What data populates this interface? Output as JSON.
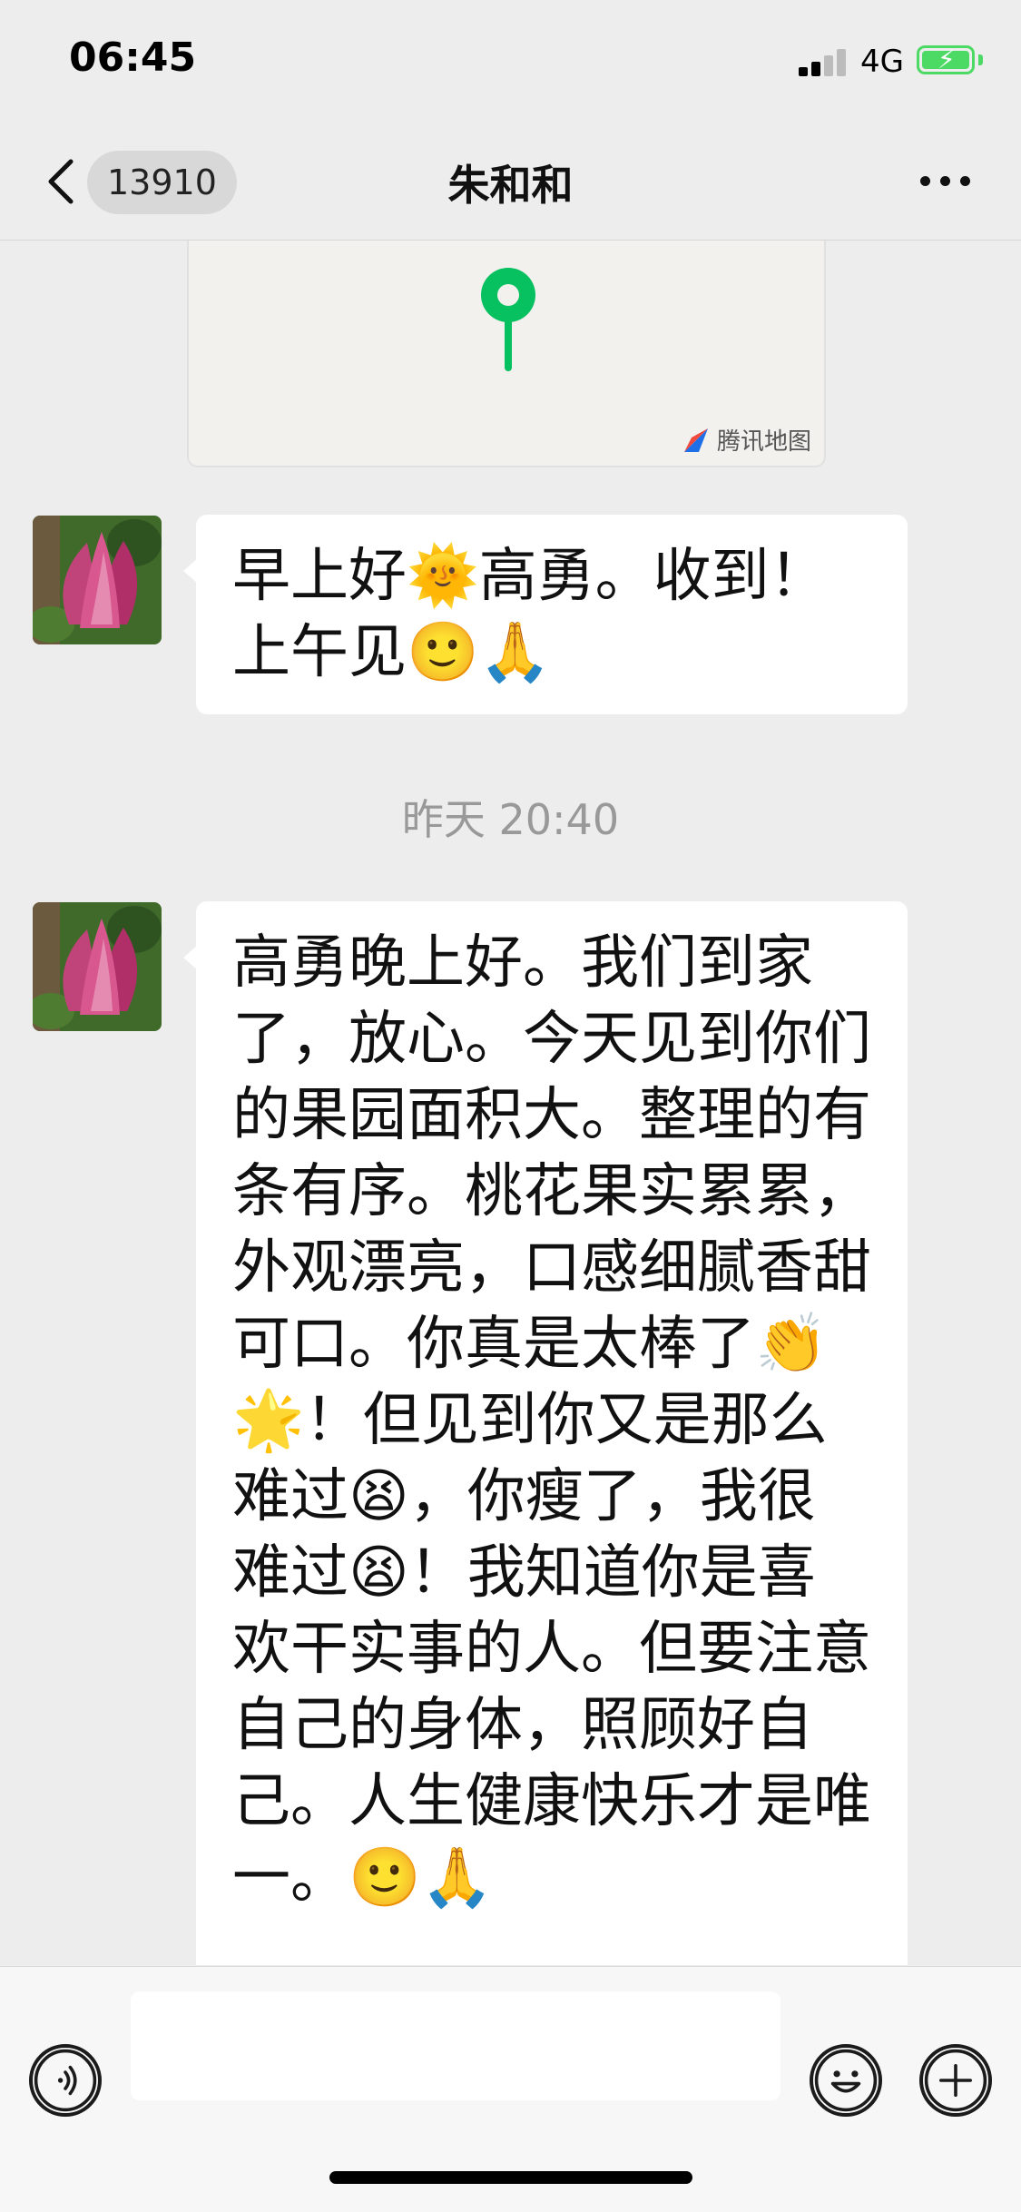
{
  "status_bar": {
    "time": "06:45",
    "network": "4G"
  },
  "nav": {
    "back_badge": "13910",
    "title": "朱和和"
  },
  "map_card": {
    "brand": "腾讯地图",
    "pin_color": "#07c160"
  },
  "messages": [
    {
      "text": "早上好🌞高勇。收到！上午见🙂🙏"
    },
    {
      "text": "高勇晚上好。我们到家了，放心。今天见到你们的果园面积大。整理的有条有序。桃花果实累累，外观漂亮，口感细腻香甜可口。你真是太棒了👏🌟！但见到你又是那么难过😫，你瘦了，我很难过😫！我知道你是喜欢干实事的人。但要注意自己的身体，照顾好自己。人生健康快乐才是唯一。🙂🙏"
    }
  ],
  "timestamp": "昨天 20:40",
  "input_bar": {
    "voice_icon": "voice-icon",
    "emoji_icon": "emoji-icon",
    "plus_icon": "plus-icon"
  },
  "colors": {
    "background": "#ededed",
    "bubble": "#ffffff",
    "accent": "#07c160",
    "battery": "#4cd964"
  }
}
